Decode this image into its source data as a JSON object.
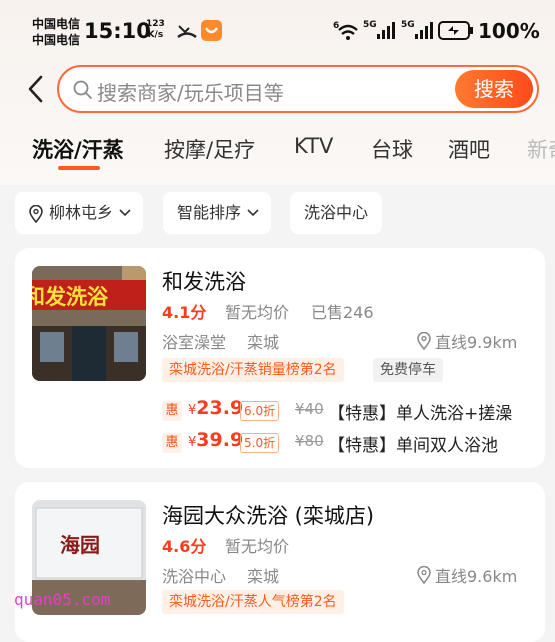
{
  "status_bar": {
    "carrier_line1": "中国电信",
    "carrier_line2": "中国电信",
    "time": "15:10",
    "speed_value": "123",
    "speed_unit": "K/s",
    "net_label_1": "6",
    "net_label_2": "5G",
    "net_label_3": "5G",
    "battery": "100%"
  },
  "search": {
    "placeholder": "搜索商家/玩乐项目等",
    "button": "搜索"
  },
  "tabs": [
    "洗浴/汗蒸",
    "按摩/足疗",
    "KTV",
    "台球",
    "酒吧",
    "新奇"
  ],
  "filters": {
    "location": "柳林屯乡",
    "sort": "智能排序",
    "category": "洗浴中心"
  },
  "shops": [
    {
      "name": "和发洗浴",
      "score": "4.1分",
      "avg_price": "暂无均价",
      "sold": "已售246",
      "category": "浴室澡堂",
      "area": "栾城",
      "distance": "直线9.9km",
      "rank_tag": "栾城洗浴/汗蒸销量榜第2名",
      "extra_tag": "免费停车",
      "thumb_sign": "和发洗浴",
      "deals": [
        {
          "badge": "惠",
          "currency": "¥",
          "price": "23.9",
          "discount": "6.0折",
          "original": "¥40",
          "desc": "【特惠】单人洗浴+搓澡"
        },
        {
          "badge": "惠",
          "currency": "¥",
          "price": "39.9",
          "discount": "5.0折",
          "original": "¥80",
          "desc": "【特惠】单间双人浴池"
        }
      ]
    },
    {
      "name": "海园大众洗浴 (栾城店)",
      "score": "4.6分",
      "avg_price": "暂无均价",
      "category": "洗浴中心",
      "area": "栾城",
      "distance": "直线9.6km",
      "rank_tag": "栾城洗浴/汗蒸人气榜第2名",
      "thumb_sign": "海园"
    }
  ],
  "watermark": "quan05.com",
  "colors": {
    "accent": "#ff5a1f",
    "price": "#ff3b1f"
  }
}
